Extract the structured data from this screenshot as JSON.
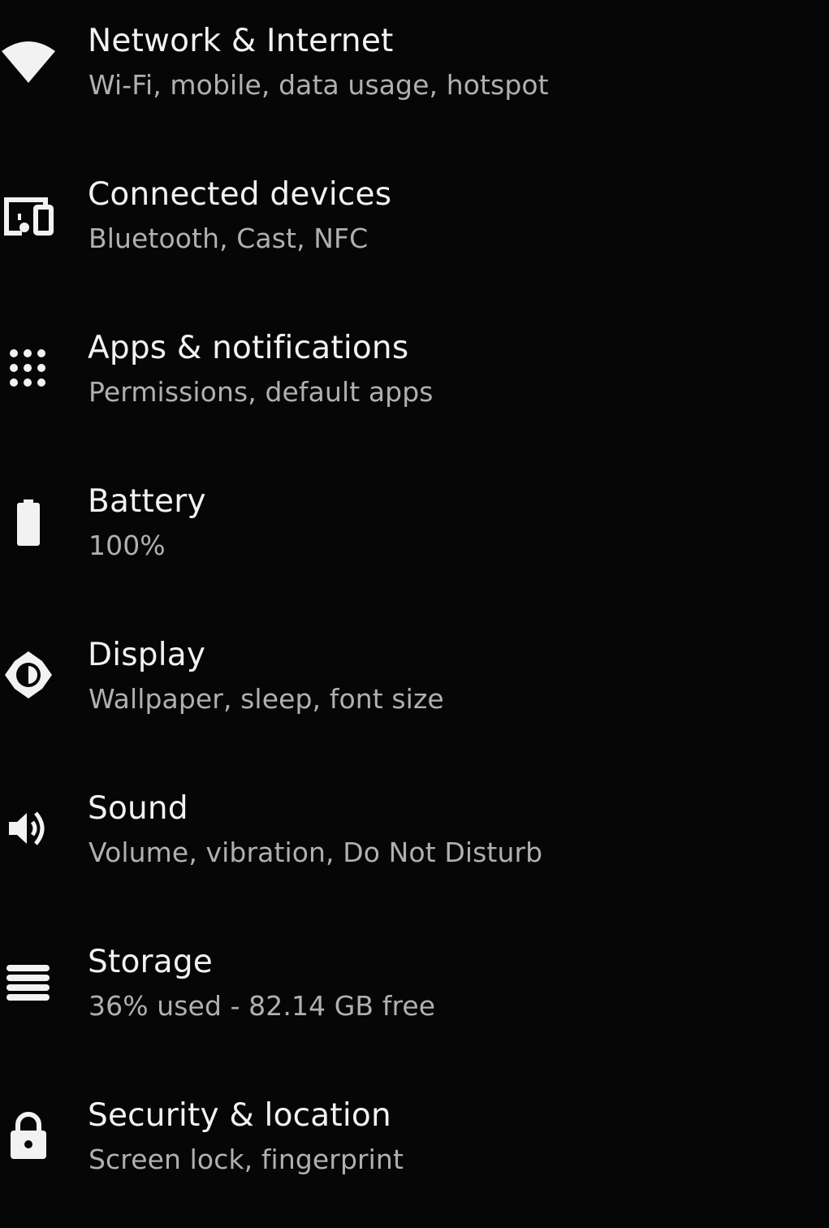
{
  "settings": {
    "items": [
      {
        "id": "network",
        "title": "Network & Internet",
        "summary": "Wi-Fi, mobile, data usage, hotspot",
        "icon": "wifi-icon"
      },
      {
        "id": "connected-devices",
        "title": "Connected devices",
        "summary": "Bluetooth, Cast, NFC",
        "icon": "devices-icon"
      },
      {
        "id": "apps",
        "title": "Apps & notifications",
        "summary": "Permissions, default apps",
        "icon": "apps-grid-icon"
      },
      {
        "id": "battery",
        "title": "Battery",
        "summary": "100%",
        "icon": "battery-icon"
      },
      {
        "id": "display",
        "title": "Display",
        "summary": "Wallpaper, sleep, font size",
        "icon": "brightness-icon"
      },
      {
        "id": "sound",
        "title": "Sound",
        "summary": "Volume, vibration, Do Not Disturb",
        "icon": "volume-icon"
      },
      {
        "id": "storage",
        "title": "Storage",
        "summary": "36% used - 82.14 GB free",
        "icon": "storage-icon"
      },
      {
        "id": "security",
        "title": "Security & location",
        "summary": "Screen lock, fingerprint",
        "icon": "lock-icon"
      }
    ]
  },
  "colors": {
    "background": "#060606",
    "title": "#f2f2f2",
    "summary": "#b0b0b0",
    "icon": "#f2f2f2"
  }
}
